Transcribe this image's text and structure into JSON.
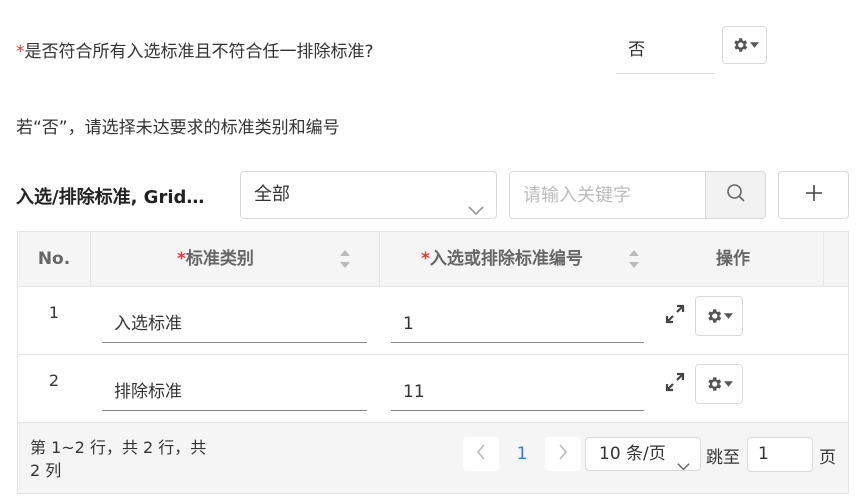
{
  "question": {
    "required_mark": "*",
    "label": "是否符合所有入选标准且不符合任一排除标准?",
    "value": "否"
  },
  "hint": "若“否”，请选择未达要求的标准类别和编号",
  "grid": {
    "title": "入选/排除标准, Grid…",
    "filter_value": "全部",
    "search_placeholder": "请输入关键字",
    "columns": {
      "no": "No.",
      "category_required": "*",
      "category": "标准类别",
      "code_required": "*",
      "code": "入选或排除标准编号",
      "actions": "操作"
    },
    "rows": [
      {
        "no": "1",
        "category": "入选标准",
        "code": "1"
      },
      {
        "no": "2",
        "category": "排除标准",
        "code": "11"
      }
    ]
  },
  "pagination": {
    "summary": "第 1~2 行，共 2 行，共 2 列",
    "current_page": "1",
    "page_size": "10 条/页",
    "jump_label": "跳至",
    "jump_value": "1",
    "jump_unit": "页"
  },
  "icons": {
    "settings": "gear-icon",
    "dropdown": "caret-down-icon",
    "search": "search-icon",
    "add": "plus-icon",
    "sort": "sort-icon",
    "expand": "expand-icon"
  },
  "colors": {
    "required": "#e4393c",
    "accent": "#3b7ed0"
  }
}
